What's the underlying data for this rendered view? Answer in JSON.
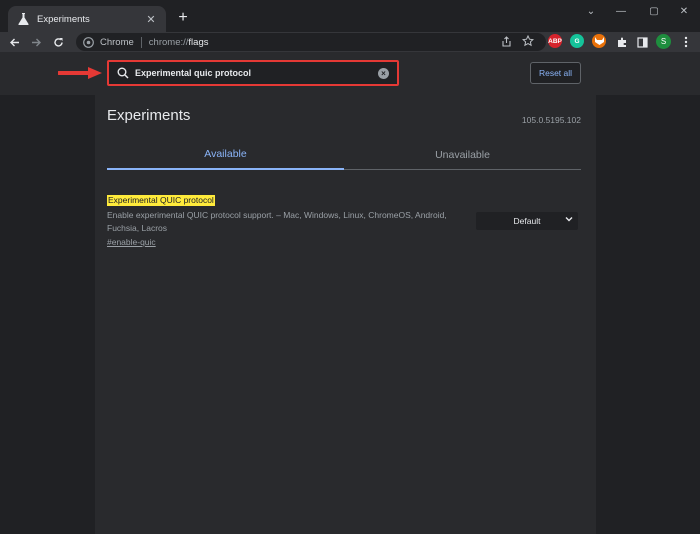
{
  "window": {
    "tab_title": "Experiments",
    "tab_close": "✕",
    "new_tab": "+",
    "controls": {
      "minimize": "⌄",
      "restore": "—",
      "maximize": "▢",
      "close": "✕"
    }
  },
  "toolbar": {
    "omnibox_label": "Chrome",
    "url_scheme": "chrome://",
    "url_path": "flags",
    "extensions": [
      {
        "name": "adblock-plus",
        "label": "ABP",
        "color": "#d6232c"
      },
      {
        "name": "grammarly",
        "label": "G",
        "color": "#15c39a"
      },
      {
        "name": "fox-extension",
        "label": "",
        "color": "#e8710a"
      }
    ],
    "profile_initial": "S"
  },
  "search": {
    "value": "Experimental quic protocol",
    "placeholder": "Search flags"
  },
  "reset_label": "Reset all",
  "page": {
    "title": "Experiments",
    "version": "105.0.5195.102",
    "tabs": {
      "available": "Available",
      "unavailable": "Unavailable"
    }
  },
  "flag": {
    "name": "Experimental QUIC protocol",
    "description": "Enable experimental QUIC protocol support. – Mac, Windows, Linux, ChromeOS, Android, Fuchsia, Lacros",
    "link": "#enable-quic",
    "selected": "Default"
  },
  "colors": {
    "highlight": "#ffeb3b",
    "accent": "#8ab4f8",
    "annotation": "#e53935"
  }
}
